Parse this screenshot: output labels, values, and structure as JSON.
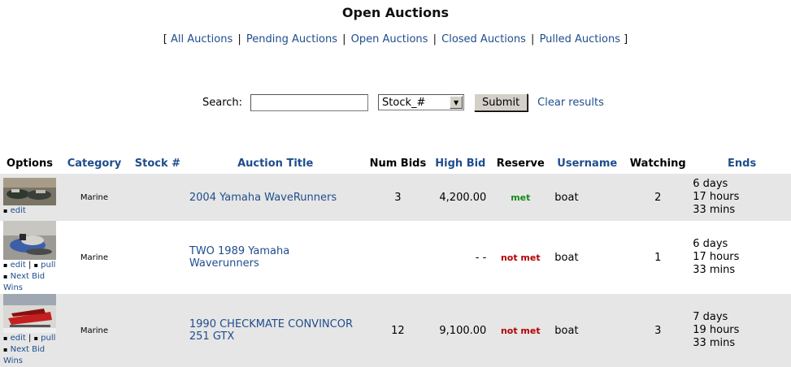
{
  "page": {
    "title": "Open Auctions"
  },
  "nav": {
    "open_bracket": "[",
    "close_bracket": "]",
    "links": [
      "All Auctions",
      "Pending Auctions",
      "Open Auctions",
      "Closed Auctions",
      "Pulled Auctions"
    ],
    "separator": "|"
  },
  "search": {
    "label": "Search:",
    "value": "",
    "select_value": "Stock_#",
    "submit_label": "Submit",
    "clear_label": "Clear results"
  },
  "table": {
    "headers": [
      "Options",
      "Category",
      "Stock #",
      "Auction Title",
      "Num Bids",
      "High Bid",
      "Reserve",
      "Username",
      "Watching",
      "Ends"
    ],
    "rows": [
      {
        "category": "Marine",
        "stock": "",
        "title": "2004 Yamaha WaveRunners",
        "bids": "3",
        "high_bid": "4,200.00",
        "reserve": "met",
        "username": "boat",
        "watching": "2",
        "ends": [
          "6 days",
          "17 hours",
          "33 mins"
        ],
        "options": {
          "edit": "edit"
        }
      },
      {
        "category": "Marine",
        "stock": "",
        "title": "TWO 1989 Yamaha Waverunners",
        "bids": "",
        "high_bid": "- -",
        "reserve": "not met",
        "username": "boat",
        "watching": "1",
        "ends": [
          "6 days",
          "17 hours",
          "33 mins"
        ],
        "options": {
          "edit": "edit",
          "sep": "|",
          "pull": "pull",
          "next": "Next Bid Wins"
        }
      },
      {
        "category": "Marine",
        "stock": "",
        "title": "1990 CHECKMATE CONVINCOR 251 GTX",
        "bids": "12",
        "high_bid": "9,100.00",
        "reserve": "not met",
        "username": "boat",
        "watching": "3",
        "ends": [
          "7 days",
          "19 hours",
          "33 mins"
        ],
        "options": {
          "edit": "edit",
          "sep": "|",
          "pull": "pull",
          "next": "Next Bid Wins"
        }
      }
    ]
  },
  "colors": {
    "link": "#1f4d8c",
    "met": "#1a8a1a",
    "not_met": "#b40000",
    "row_shade": "#e6e6e6"
  }
}
